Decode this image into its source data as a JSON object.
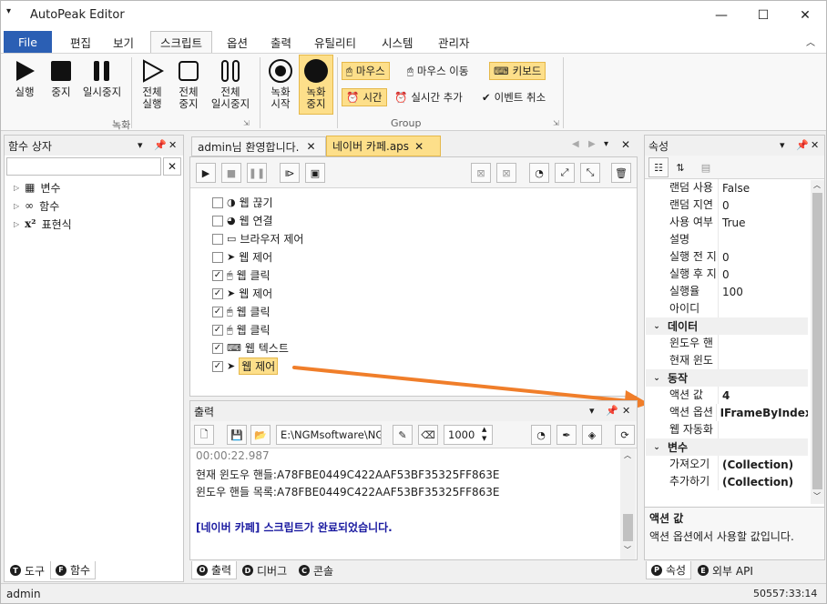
{
  "window": {
    "title": "AutoPeak Editor",
    "min": "—",
    "max": "☐",
    "close": "✕"
  },
  "menu_tabs": [
    "File",
    "편집",
    "보기",
    "스크립트",
    "옵션",
    "출력",
    "유틸리티",
    "시스템",
    "관리자"
  ],
  "ribbon": {
    "record_group": {
      "label": "녹화",
      "buttons": [
        "실행",
        "중지",
        "일시중지",
        "전체\n실행",
        "전체\n중지",
        "전체\n일시중지",
        "녹화\n시작",
        "녹화\n중지"
      ]
    },
    "group2": {
      "label": "Group",
      "items": [
        "마우스",
        "마우스 이동",
        "키보드",
        "시간",
        "실시간 추가",
        "이벤트 취소"
      ]
    }
  },
  "function_panel": {
    "title": "함수 상자",
    "tree": [
      {
        "label": "변수"
      },
      {
        "label": "함수"
      },
      {
        "label": "표현식"
      }
    ],
    "bottom_tabs": [
      "도구",
      "함수"
    ]
  },
  "editor": {
    "tabs": [
      "admin님 환영합니다.",
      "네이버 카페.aps"
    ],
    "rows": [
      {
        "label": "웹 끊기",
        "checked": false
      },
      {
        "label": "웹 연결",
        "checked": false
      },
      {
        "label": "브라우저 제어",
        "checked": false
      },
      {
        "label": "웹 제어",
        "checked": false
      },
      {
        "label": "웹 클릭",
        "checked": true
      },
      {
        "label": "웹 제어",
        "checked": true
      },
      {
        "label": "웹 클릭",
        "checked": true
      },
      {
        "label": "웹 클릭",
        "checked": true
      },
      {
        "label": "웹 텍스트",
        "checked": true
      },
      {
        "label": "웹 제어",
        "checked": true,
        "selected": true
      }
    ]
  },
  "output": {
    "title": "출력",
    "path": "E:\\NGMsoftware\\NG",
    "count": "1000",
    "lines": [
      {
        "text": "00:00:22.987",
        "style": "time"
      },
      {
        "text": "현재 윈도우 핸들:A78FBE0449C422AAF53BF35325FF863E",
        "style": "normal"
      },
      {
        "text": "윈도우 핸들 목록:A78FBE0449C422AAF53BF35325FF863E",
        "style": "normal"
      },
      {
        "text": "",
        "style": "normal"
      },
      {
        "text": "[네이버 카페] 스크립트가 완료되었습니다.",
        "style": "done"
      }
    ],
    "bottom_tabs": [
      "출력",
      "디버그",
      "콘솔"
    ]
  },
  "properties": {
    "title": "속성",
    "rows": [
      {
        "k": "랜덤 사용",
        "v": "False"
      },
      {
        "k": "랜덤 지연",
        "v": "0"
      },
      {
        "k": "사용 여부",
        "v": "True"
      },
      {
        "k": "설명",
        "v": ""
      },
      {
        "k": "실행 전 지",
        "v": "0"
      },
      {
        "k": "실행 후 지",
        "v": "0"
      },
      {
        "k": "실행율",
        "v": "100"
      },
      {
        "k": "아이디",
        "v": ""
      }
    ],
    "cat_data": "데이터",
    "data_rows": [
      {
        "k": "윈도우 핸",
        "v": ""
      },
      {
        "k": "현재 윈도",
        "v": ""
      }
    ],
    "cat_action": "동작",
    "action_rows": [
      {
        "k": "액션 값",
        "v": "4"
      },
      {
        "k": "액션 옵션",
        "v": "IFrameByIndex"
      },
      {
        "k": "웹 자동화",
        "v": ""
      }
    ],
    "cat_var": "변수",
    "var_rows": [
      {
        "k": "가져오기",
        "v": "(Collection)"
      },
      {
        "k": "추가하기",
        "v": "(Collection)"
      }
    ],
    "desc_title": "액션 값",
    "desc_text": "액션 옵션에서 사용할 값입니다.",
    "bottom_tabs": [
      "속성",
      "외부 API"
    ]
  },
  "status": {
    "left": "admin",
    "right": "50557:33:14"
  },
  "colors": {
    "file_tab": "#2b5fb4",
    "highlight": "#fddf8a",
    "arrow": "#f07e2a",
    "done_text": "#1a1aa0"
  }
}
